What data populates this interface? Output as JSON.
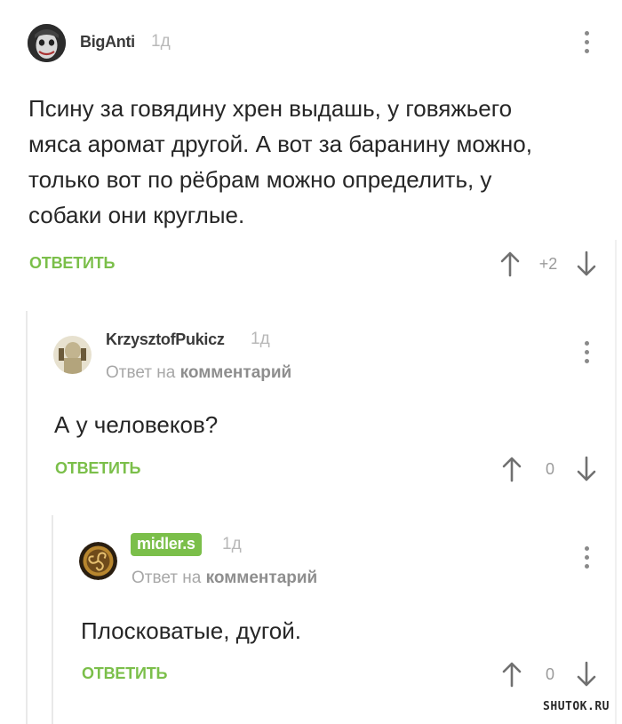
{
  "comments": [
    {
      "username": "BigAnti",
      "time": "1д",
      "text_lines": [
        "Псину за говядину хрен выдашь, у говяжьего",
        "мяса аромат другой. А вот за баранину можно,",
        "только вот по рёбрам можно определить, у",
        "собаки они круглые."
      ],
      "reply_label": "ОТВЕТИТЬ",
      "score": "+2"
    },
    {
      "username": "KrzysztofPukicz",
      "time": "1д",
      "reply_prefix": "Ответ на",
      "reply_target": "комментарий",
      "text": "А у человеков?",
      "reply_label": "ОТВЕТИТЬ",
      "score": "0"
    },
    {
      "username": "midler.s",
      "time": "1д",
      "reply_prefix": "Ответ на",
      "reply_target": "комментарий",
      "text": "Плосковатые, дугой.",
      "reply_label": "ОТВЕТИТЬ",
      "score": "0"
    }
  ],
  "watermark": "SHUTOK.RU",
  "colors": {
    "accent": "#7bbf4a",
    "text": "#262626",
    "muted": "#a7a7a7"
  }
}
